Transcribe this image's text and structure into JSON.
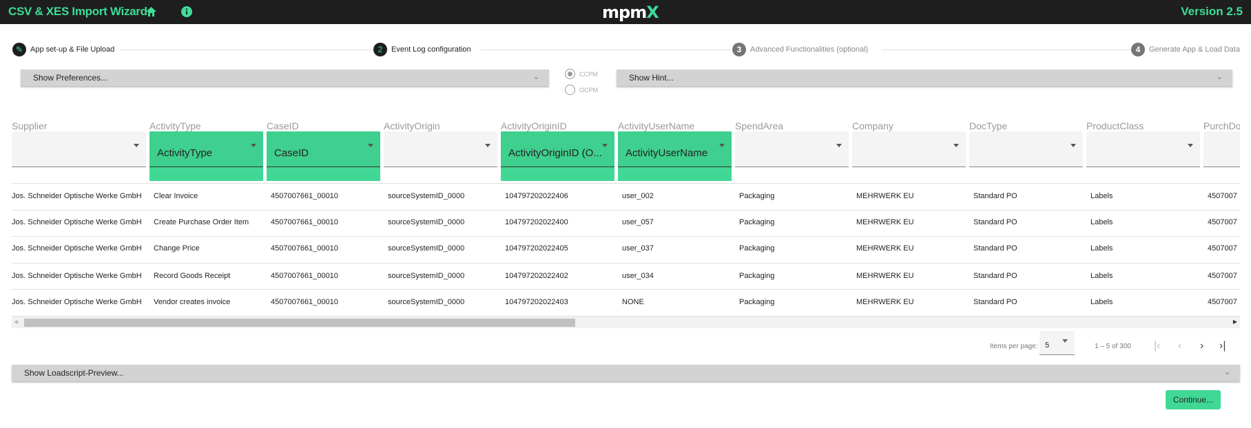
{
  "header": {
    "title": "CSV & XES Import Wizard",
    "home_icon": "home-icon",
    "info_icon": "info-icon",
    "logo": "mpmX",
    "version": "Version 2.5",
    "accent": "#3ddc97"
  },
  "stepper": [
    {
      "num": "✎",
      "label": "App set-up & File Upload",
      "state": "done"
    },
    {
      "num": "2",
      "label": "Event Log configuration",
      "state": "active"
    },
    {
      "num": "3",
      "label": "Advanced Functionalities (optional)",
      "state": "pending"
    },
    {
      "num": "4",
      "label": "Generate App & Load Data",
      "state": "pending"
    }
  ],
  "preferences": {
    "label": "Show Preferences..."
  },
  "hint": {
    "label": "Show Hint..."
  },
  "mode": {
    "options": [
      "CCPM",
      "OCPM"
    ],
    "selected": "CCPM"
  },
  "table": {
    "columns": [
      {
        "name": "Supplier",
        "mapping": "",
        "mapped": false
      },
      {
        "name": "ActivityType",
        "mapping": "ActivityType",
        "mapped": true
      },
      {
        "name": "CaseID",
        "mapping": "CaseID",
        "mapped": true
      },
      {
        "name": "ActivityOrigin",
        "mapping": "",
        "mapped": false
      },
      {
        "name": "ActivityOriginID",
        "mapping": "ActivityOriginID (O...",
        "mapped": true
      },
      {
        "name": "ActivityUserName",
        "mapping": "ActivityUserName",
        "mapped": true
      },
      {
        "name": "SpendArea",
        "mapping": "",
        "mapped": false
      },
      {
        "name": "Company",
        "mapping": "",
        "mapped": false
      },
      {
        "name": "DocType",
        "mapping": "",
        "mapped": false
      },
      {
        "name": "ProductClass",
        "mapping": "",
        "mapped": false
      },
      {
        "name": "PurchDoc",
        "mapping": "",
        "mapped": false
      }
    ],
    "rows": [
      [
        "Jos. Schneider Optische Werke GmbH",
        "Clear Invoice",
        "4507007661_00010",
        "sourceSystemID_0000",
        "104797202022406",
        "user_002",
        "Packaging",
        "MEHRWERK EU",
        "Standard PO",
        "Labels",
        "4507007"
      ],
      [
        "Jos. Schneider Optische Werke GmbH",
        "Create Purchase Order Item",
        "4507007661_00010",
        "sourceSystemID_0000",
        "104797202022400",
        "user_057",
        "Packaging",
        "MEHRWERK EU",
        "Standard PO",
        "Labels",
        "4507007"
      ],
      [
        "Jos. Schneider Optische Werke GmbH",
        "Change Price",
        "4507007661_00010",
        "sourceSystemID_0000",
        "104797202022405",
        "user_037",
        "Packaging",
        "MEHRWERK EU",
        "Standard PO",
        "Labels",
        "4507007"
      ],
      [
        "Jos. Schneider Optische Werke GmbH",
        "Record Goods Receipt",
        "4507007661_00010",
        "sourceSystemID_0000",
        "104797202022402",
        "user_034",
        "Packaging",
        "MEHRWERK EU",
        "Standard PO",
        "Labels",
        "4507007"
      ],
      [
        "Jos. Schneider Optische Werke GmbH",
        "Vendor creates invoice",
        "4507007661_00010",
        "sourceSystemID_0000",
        "104797202022403",
        "NONE",
        "Packaging",
        "MEHRWERK EU",
        "Standard PO",
        "Labels",
        "4507007"
      ]
    ]
  },
  "paginator": {
    "items_label": "Items per page:",
    "page_size": "5",
    "range": "1 – 5 of 300"
  },
  "loadscript": {
    "label": "Show Loadscript-Preview..."
  },
  "continue_label": "Continue..."
}
